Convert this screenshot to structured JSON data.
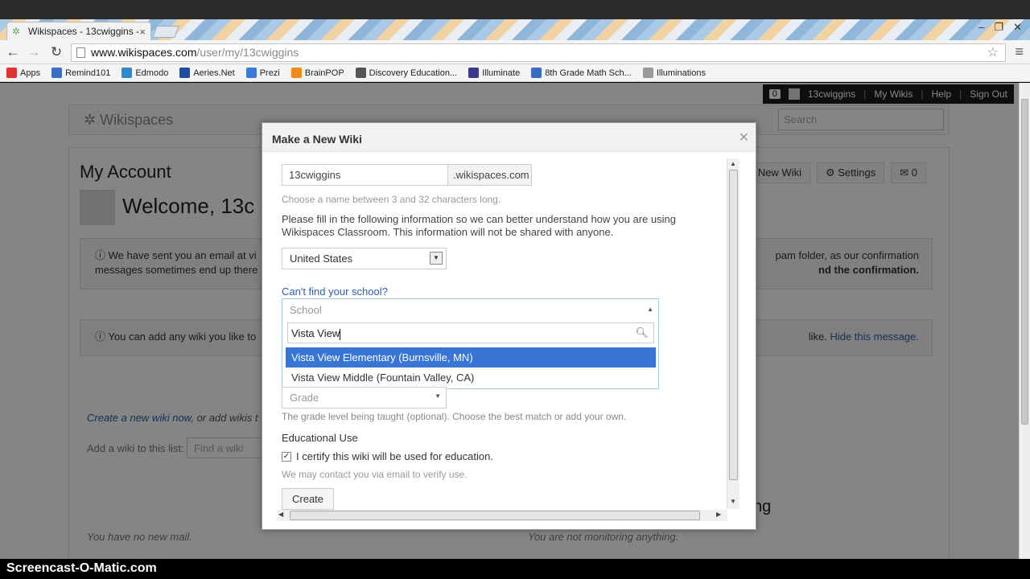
{
  "browser": {
    "tab_title": "Wikispaces - 13cwiggins -",
    "url_host": "www.wikispaces.com",
    "url_path": "/user/my/13cwiggins",
    "bookmarks": [
      {
        "label": "Apps",
        "color": "#d33"
      },
      {
        "label": "Remind101",
        "color": "#3a6fc4"
      },
      {
        "label": "Edmodo",
        "color": "#2d8ad1"
      },
      {
        "label": "Aeries.Net",
        "color": "#1e4ea0"
      },
      {
        "label": "Prezi",
        "color": "#3c7ad9"
      },
      {
        "label": "BrainPOP",
        "color": "#f08a1c"
      },
      {
        "label": "Discovery Education...",
        "color": "#555"
      },
      {
        "label": "Illuminate",
        "color": "#3a3a8c"
      },
      {
        "label": "8th Grade Math Sch...",
        "color": "#3b6cc4"
      },
      {
        "label": "Illuminations",
        "color": "#999"
      }
    ]
  },
  "userbar": {
    "count": "0",
    "username": "13cwiggins",
    "links": [
      "My Wikis",
      "Help",
      "Sign Out"
    ]
  },
  "site": {
    "logo": "Wikispaces",
    "search_placeholder": "Search"
  },
  "account": {
    "title": "My Account",
    "welcome": "Welcome, 13c",
    "actions": [
      "New Wiki",
      "Settings",
      "0"
    ],
    "alert1_left": "We have sent you an email at vi",
    "alert1_left2": "messages sometimes end up there",
    "alert1_right": "pam folder, as our confirmation",
    "alert1_right2": "nd the confirmation.",
    "alert2_left": "You can add any wiki you like to",
    "alert2_right": "like.",
    "alert2_link": "Hide this message.",
    "create_link": "Create a new wiki now",
    "create_rest": ", or add wikis t",
    "add_label": "Add a wiki to this list:",
    "find_placeholder": "Find a wiki",
    "no_mail": "You have no new mail.",
    "no_monitor": "You are not monitoring anything.",
    "monitor_title": "ng"
  },
  "modal": {
    "title": "Make a New Wiki",
    "wiki_name": "13cwiggins",
    "domain_suffix": ".wikispaces.com",
    "name_help": "Choose a name between 3 and 32 characters long.",
    "intro": "Please fill in the following information so we can better understand how you are using Wikispaces Classroom. This information will not be shared with anyone.",
    "country": "United States",
    "cant_find": "Can't find your school?",
    "school_placeholder": "School",
    "school_search": "Vista View",
    "options": [
      "Vista View Elementary (Burnsville, MN)",
      "Vista View Middle (Fountain Valley, CA)"
    ],
    "grade_placeholder": "Grade",
    "grade_help": "The grade level being taught (optional). Choose the best match or add your own.",
    "edu_heading": "Educational Use",
    "certify_label": "I certify this wiki will be used for education.",
    "contact_note": "We may contact you via email to verify use.",
    "create_label": "Create"
  },
  "recorder": {
    "brand": "Screencast-O-Matic.com"
  }
}
